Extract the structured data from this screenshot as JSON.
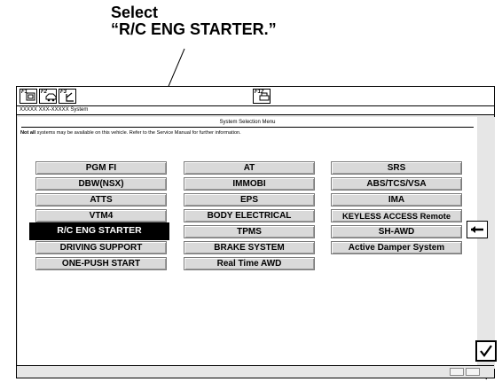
{
  "callout": {
    "line1": "Select",
    "line2": "“R/C ENG STARTER.”"
  },
  "toolbar": {
    "f1_label": "F1",
    "f2_label": "F2",
    "f3_label": "F3",
    "f12_label": "F12"
  },
  "window": {
    "system_label": "XXXXX XXX-XXXXX System"
  },
  "menu": {
    "title": "System Selection Menu",
    "notice_bold": "Not all",
    "notice_text": " systems may be available on this vehicle. Refer to the Service Manual for further information.",
    "columns": [
      [
        "PGM FI",
        "DBW(NSX)",
        "ATTS",
        "VTM4",
        "R/C ENG STARTER",
        "DRIVING SUPPORT",
        "ONE-PUSH START"
      ],
      [
        "AT",
        "IMMOBI",
        "EPS",
        "BODY ELECTRICAL",
        "TPMS",
        "BRAKE SYSTEM",
        "Real Time AWD"
      ],
      [
        "SRS",
        "ABS/TCS/VSA",
        "IMA",
        "KEYLESS ACCESS Remote",
        "SH-AWD",
        "Active Damper System"
      ]
    ],
    "selected": "R/C ENG STARTER"
  },
  "icons": {
    "f1": "print-screen-icon",
    "f2": "vehicle-icon",
    "f3": "return-icon",
    "f12": "printer-icon",
    "back": "left-arrow-icon",
    "confirm": "checkmark-icon"
  }
}
